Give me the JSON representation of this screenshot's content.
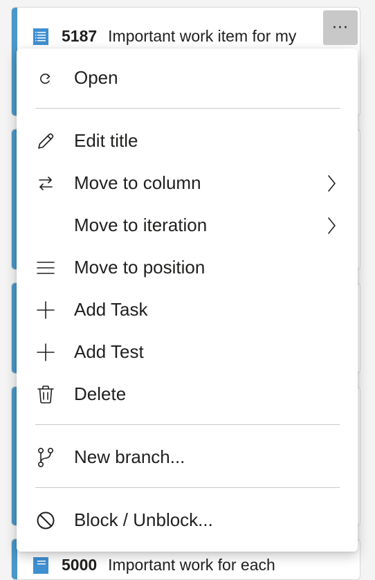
{
  "card_top": {
    "id": "5187",
    "title": "Important work item for my"
  },
  "card_bottom": {
    "id": "5000",
    "title": "Important work for each"
  },
  "more_button": {
    "label": "···"
  },
  "menu": {
    "items": [
      {
        "label": "Open",
        "icon": "open-icon"
      },
      {
        "label": "Edit title",
        "icon": "pencil-icon"
      },
      {
        "label": "Move to column",
        "icon": "swap-arrows-icon",
        "submenu": true
      },
      {
        "label": "Move to iteration",
        "icon": "",
        "submenu": true
      },
      {
        "label": "Move to position",
        "icon": "list-lines-icon"
      },
      {
        "label": "Add Task",
        "icon": "plus-icon"
      },
      {
        "label": "Add Test",
        "icon": "plus-icon"
      },
      {
        "label": "Delete",
        "icon": "trash-icon"
      },
      {
        "label": "New branch...",
        "icon": "branch-icon"
      },
      {
        "label": "Block / Unblock...",
        "icon": "block-icon"
      }
    ]
  },
  "colors": {
    "card_accent": "#4a98c8",
    "work_item_icon": "#3f8fd2",
    "more_button_bg": "#c8c8c8"
  }
}
